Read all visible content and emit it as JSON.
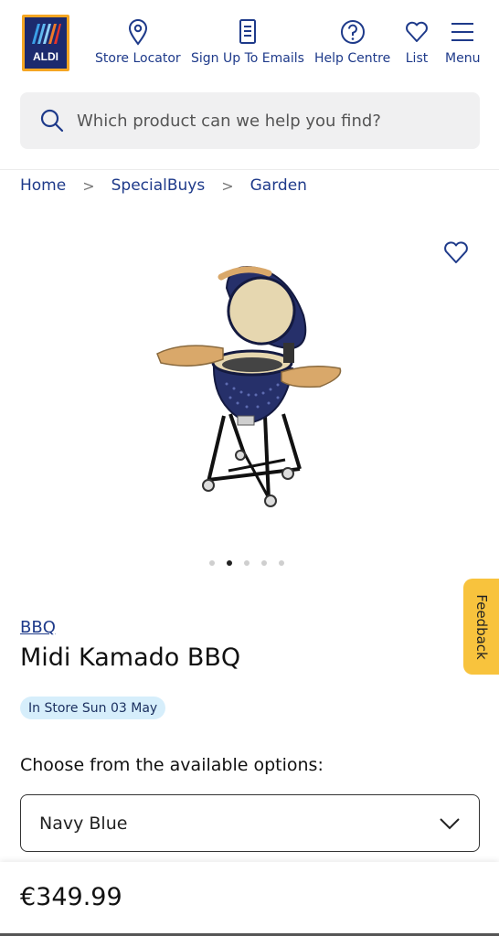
{
  "header": {
    "logo_text": "ALDI",
    "nav": [
      {
        "label": "Store Locator",
        "icon": "map-pin-icon"
      },
      {
        "label": "Sign Up To Emails",
        "icon": "newsletter-icon"
      },
      {
        "label": "Help Centre",
        "icon": "help-icon"
      },
      {
        "label": "List",
        "icon": "heart-icon"
      },
      {
        "label": "Menu",
        "icon": "hamburger-icon"
      }
    ]
  },
  "search": {
    "placeholder": "Which product can we help you find?"
  },
  "breadcrumb": [
    "Home",
    "SpecialBuys",
    "Garden"
  ],
  "gallery": {
    "slide_count": 5,
    "active_slide": 2
  },
  "feedback_label": "Feedback",
  "product": {
    "category": "BBQ",
    "title": "Midi Kamado BBQ",
    "availability": "In Store Sun 03 May",
    "options_label": "Choose from the available options:",
    "selected_option": "Navy Blue",
    "price": "€349.99"
  },
  "colors": {
    "brand_blue": "#1e3a8a",
    "logo_bg": "#1c2a6e",
    "logo_border": "#f5a623",
    "feedback_bg": "#f8c33d",
    "badge_bg": "#d6eefb"
  }
}
